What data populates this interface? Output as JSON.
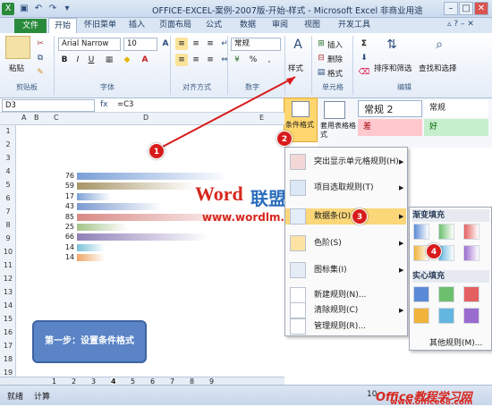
{
  "window": {
    "title": "OFFICE-EXCEL-案例-2007版-开始-样式 - Microsoft Excel 非商业用途"
  },
  "tabs": [
    "文件",
    "开始",
    "怀旧菜单",
    "插入",
    "页面布局",
    "公式",
    "数据",
    "审阅",
    "视图",
    "开发工具"
  ],
  "ribbon": {
    "paste_label": "粘贴",
    "font_name": "Arial Narrow",
    "font_size": "10",
    "number_format": "常规",
    "percent": "%",
    "comma": ",",
    "style_label": "样式",
    "insert_label": "插入",
    "delete_label": "删除",
    "format_label": "格式",
    "sort_label": "排序和筛选",
    "find_label": "查找和选择",
    "groups": {
      "clipboard": "剪贴板",
      "font": "字体",
      "align": "对齐方式",
      "number": "数字",
      "cells": "单元格",
      "edit": "编辑"
    }
  },
  "formula_bar": {
    "name_box": "D3",
    "formula": "=C3"
  },
  "style_panel": {
    "cf_label": "条件格式",
    "table_label": "套用表格格式",
    "styles": [
      "常规 2",
      "常规",
      "差",
      "好"
    ]
  },
  "sheet": {
    "columns": [
      "A",
      "B",
      "C",
      "D",
      "E"
    ],
    "rows": [
      "1",
      "2",
      "3",
      "4",
      "5",
      "6",
      "7",
      "8",
      "9",
      "10",
      "11",
      "12",
      "13",
      "14",
      "15",
      "16",
      "17",
      "18",
      "19"
    ],
    "values": [
      "76",
      "59",
      "17",
      "43",
      "85",
      "25",
      "66",
      "14",
      "14"
    ],
    "bar_fractions": [
      0.894,
      0.694,
      0.2,
      0.506,
      1.0,
      0.294,
      0.776,
      0.165,
      0.165
    ],
    "bar_colors": [
      "#7a9fd8",
      "#a79567",
      "#7fa2d6",
      "#7c9bd0",
      "#d88a86",
      "#a4c48a",
      "#8f80b8",
      "#7cc2d8",
      "#f0a768"
    ],
    "sheet_tabs": [
      "1",
      "2",
      "3",
      "4",
      "5",
      "6",
      "7",
      "8",
      "9"
    ]
  },
  "watermark": {
    "logo_word": "Word",
    "logo_cn": "联盟",
    "url": "www.wordlm.com",
    "bottom": "Office教程学习网",
    "bottom_url": "www.office68.com"
  },
  "cf_menu": {
    "items": [
      {
        "label": "突出显示单元格规则(H)",
        "arrow": true
      },
      {
        "label": "项目选取规则(T)",
        "arrow": true
      },
      {
        "label": "数据条(D)",
        "arrow": true
      },
      {
        "label": "色阶(S)",
        "arrow": true
      },
      {
        "label": "图标集(I)",
        "arrow": true
      },
      {
        "label": "新建规则(N)...",
        "arrow": false
      },
      {
        "label": "清除规则(C)",
        "arrow": true
      },
      {
        "label": "管理规则(R)...",
        "arrow": false
      }
    ]
  },
  "databar_submenu": {
    "gradient_header": "渐变填充",
    "solid_header": "实心填充",
    "more_rules": "其他规则(M)...",
    "swatch_colors": [
      "#5b8ad6",
      "#6cbf6c",
      "#e56060",
      "#f0b33c",
      "#63b6e0",
      "#9b6ccf"
    ]
  },
  "markers": [
    "1",
    "2",
    "3",
    "4"
  ],
  "callout": "第一步：设置条件格式",
  "status": {
    "ready": "就绪",
    "calc": "计算",
    "zoom": "10"
  }
}
